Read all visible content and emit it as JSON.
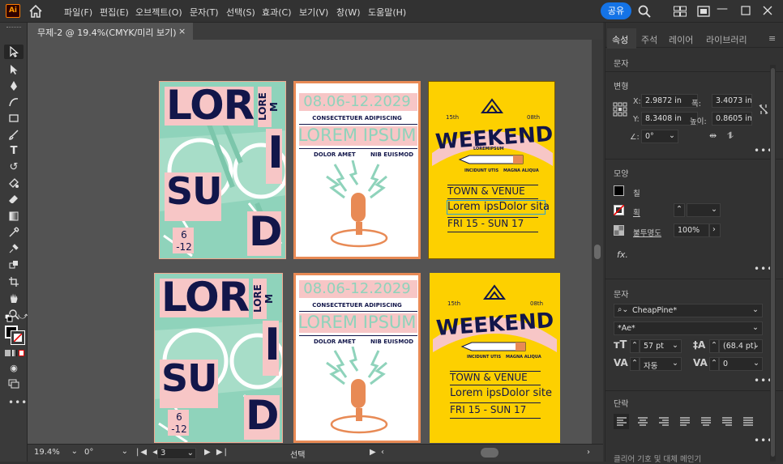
{
  "app": {
    "logo": "Ai"
  },
  "menu": [
    "파일(F)",
    "편집(E)",
    "오브젝트(O)",
    "문자(T)",
    "선택(S)",
    "효과(C)",
    "보기(V)",
    "창(W)",
    "도움말(H)"
  ],
  "header": {
    "share_label": "공유"
  },
  "document_tab": {
    "title": "무제-2 @ 19.4%(CMYK/미리 보기)",
    "close": "×"
  },
  "status": {
    "zoom": "19.4%",
    "rotation": "0°",
    "artboard_num": "3",
    "mode": "선택"
  },
  "panel": {
    "tabs": [
      "속성",
      "주석",
      "레이어",
      "라이브러리"
    ],
    "active_tab": "속성",
    "selection_label": "문자",
    "transform": {
      "title": "변형",
      "x_label": "X:",
      "x": "2.9872 in",
      "y_label": "Y:",
      "y": "8.3408 in",
      "w_label": "폭:",
      "w": "3.4073 in",
      "h_label": "높이:",
      "h": "0.8605 in",
      "angle": "0°"
    },
    "appearance": {
      "title": "모양",
      "fill": "칠",
      "stroke": "획",
      "opacity_label": "불투명도",
      "opacity": "100%",
      "fx": "fx."
    },
    "character": {
      "title": "문자",
      "font": "CheapPine*",
      "style": "*Ae*",
      "size": "57 pt",
      "leading": "(68.4 pt)",
      "kerning": "자동",
      "tracking": "0"
    },
    "paragraph": {
      "title": "단락",
      "bottom_text": "클리어 기호 및 대체 메인기"
    }
  },
  "artwork": {
    "poster1": {
      "lor": "LOR",
      "lore_m": "LORE M",
      "i": "I",
      "su": "SU",
      "d": "D",
      "dates": "6 -12"
    },
    "poster2": {
      "date": "08.06-12.2029",
      "sub": "CONSECTETUER ADIPISCING",
      "title": "LOREM IPSUM",
      "left": "DOLOR AMET",
      "right": "NIB EUISMOD"
    },
    "poster3": {
      "weekend": "WEEKEND",
      "n15": "15th",
      "n08": "08th",
      "small": "LOREMIPSUM",
      "incidunt": "INCIDUNT UTIS",
      "magna": "MAGNA ALIQUA",
      "venue": "TOWN & VENUE",
      "lorem_top": "Lorem ipsDolor sita",
      "lorem_bottom": "Lorem ipsDolor site",
      "fri": "FRI 15 - SUN 17"
    }
  },
  "colors": {
    "accent": "#1473e6",
    "mint": "#8fd3bb",
    "pink": "#f7c6c6",
    "navy": "#12164a",
    "orange": "#e88a55",
    "yellow": "#fdd000",
    "ai_orange": "#ff9a00"
  }
}
